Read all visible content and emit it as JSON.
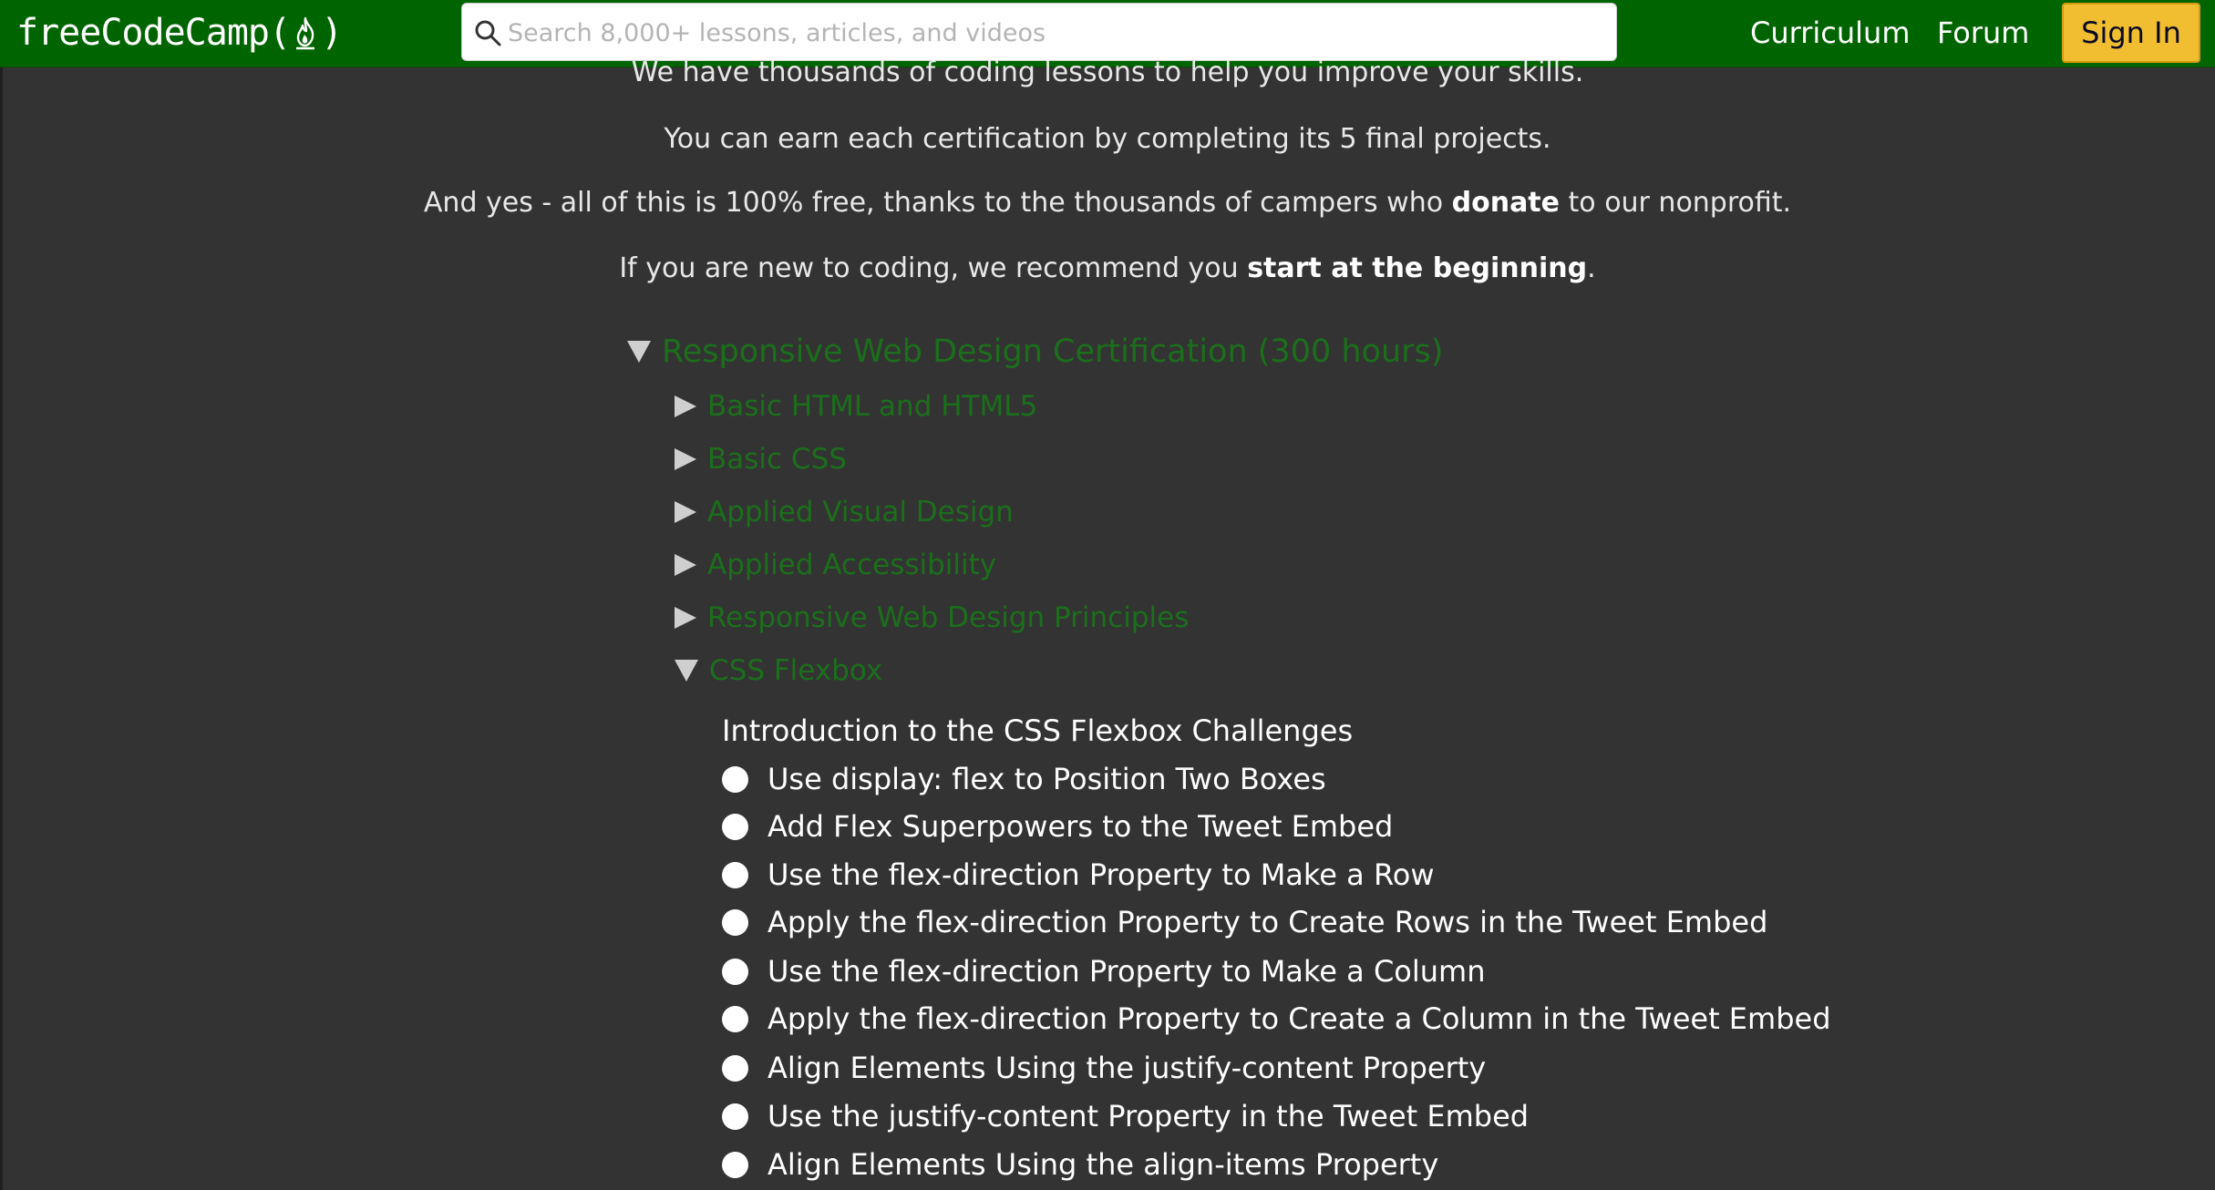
{
  "navbar": {
    "logo_text": "freeCodeCamp",
    "logo_paren_open": "(",
    "logo_paren_close": ")",
    "search_placeholder": "Search 8,000+ lessons, articles, and videos",
    "links": {
      "curriculum": "Curriculum",
      "forum": "Forum"
    },
    "signin_label": "Sign In",
    "colors": {
      "navbar_bg": "#006400",
      "signin_bg": "#f1be32"
    }
  },
  "intro": {
    "partial_line": "We have thousands of coding lessons to help you improve your skills.",
    "line1": "You can earn each certification by completing its 5 final projects.",
    "line2_before": "And yes - all of this is 100% free, thanks to the thousands of campers who ",
    "line2_link": "donate",
    "line2_after": " to our nonprofit.",
    "line3_before": "If you are new to coding, we recommend you ",
    "line3_link": "start at the beginning",
    "line3_after": "."
  },
  "certification": {
    "title": "Responsive Web Design Certification (300 hours)",
    "expanded": true,
    "blocks": [
      {
        "label": "Basic HTML and HTML5",
        "expanded": false
      },
      {
        "label": "Basic CSS",
        "expanded": false
      },
      {
        "label": "Applied Visual Design",
        "expanded": false
      },
      {
        "label": "Applied Accessibility",
        "expanded": false
      },
      {
        "label": "Responsive Web Design Principles",
        "expanded": false
      },
      {
        "label": "CSS Flexbox",
        "expanded": true
      }
    ],
    "flexbox": {
      "intro": "Introduction to the CSS Flexbox Challenges",
      "challenges": [
        "Use display: flex to Position Two Boxes",
        "Add Flex Superpowers to the Tweet Embed",
        "Use the flex-direction Property to Make a Row",
        "Apply the flex-direction Property to Create Rows in the Tweet Embed",
        "Use the flex-direction Property to Make a Column",
        "Apply the flex-direction Property to Create a Column in the Tweet Embed",
        "Align Elements Using the justify-content Property",
        "Use the justify-content Property in the Tweet Embed",
        "Align Elements Using the align-items Property"
      ]
    }
  },
  "icons": {
    "logo": "flame-icon",
    "search": "search-icon",
    "collapsed": "triangle-right-icon",
    "expanded": "triangle-down-icon",
    "challenge_status": "circle-icon"
  }
}
